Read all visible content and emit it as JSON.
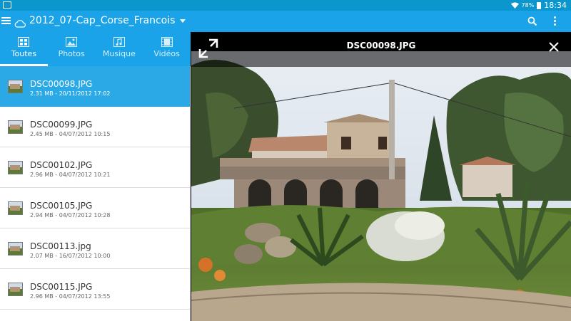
{
  "status": {
    "battery": "78%",
    "time": "18:34"
  },
  "appbar": {
    "folder_title": "2012_07-Cap_Corse_Francois"
  },
  "tabs": [
    {
      "label": "Toutes",
      "icon": "all-icon",
      "active": true
    },
    {
      "label": "Photos",
      "icon": "photo-icon",
      "active": false
    },
    {
      "label": "Musique",
      "icon": "music-icon",
      "active": false
    },
    {
      "label": "Vidéos",
      "icon": "video-icon",
      "active": false
    }
  ],
  "files": [
    {
      "name": "DSC00098.JPG",
      "meta": "2.31 MB - 20/11/2012 17:02",
      "selected": true
    },
    {
      "name": "DSC00099.JPG",
      "meta": "2.45 MB - 04/07/2012 10:15",
      "selected": false
    },
    {
      "name": "DSC00102.JPG",
      "meta": "2.96 MB - 04/07/2012 10:21",
      "selected": false
    },
    {
      "name": "DSC00105.JPG",
      "meta": "2.94 MB - 04/07/2012 10:28",
      "selected": false
    },
    {
      "name": "DSC00113.jpg",
      "meta": "2.07 MB - 16/07/2012 10:00",
      "selected": false
    },
    {
      "name": "DSC00115.JPG",
      "meta": "2.96 MB - 04/07/2012 13:55",
      "selected": false
    }
  ],
  "viewer": {
    "title": "DSC00098.JPG"
  },
  "colors": {
    "accent": "#1aa3e8",
    "status_bar": "#0b97cd",
    "selected_row": "#2ba9e7"
  }
}
